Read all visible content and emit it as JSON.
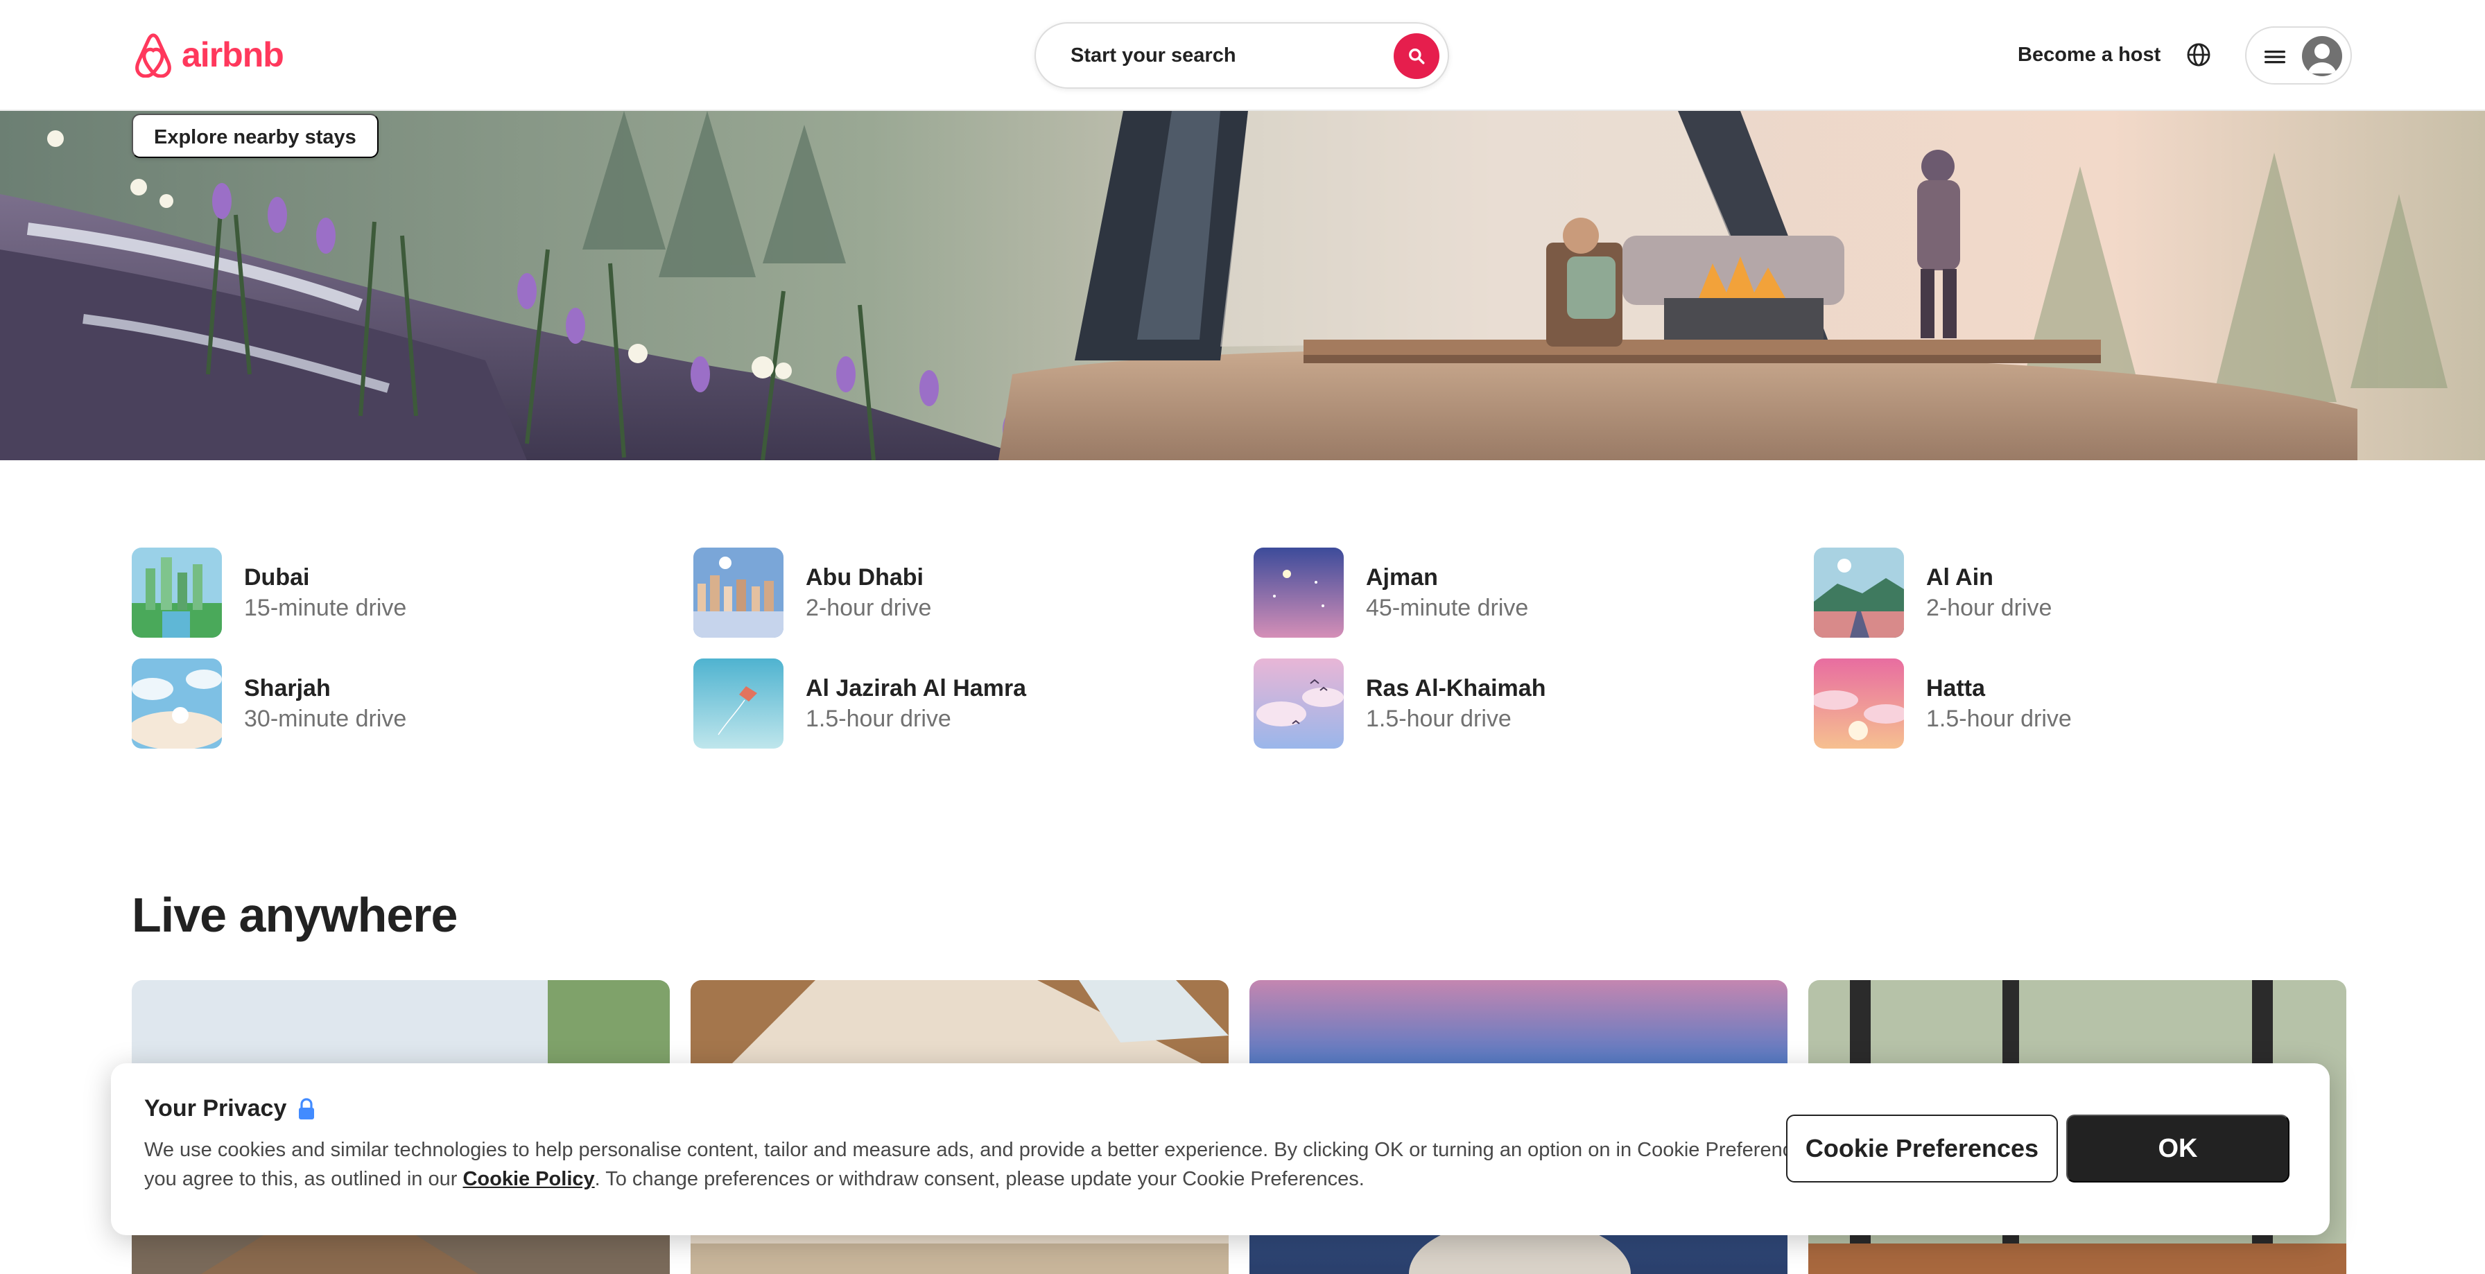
{
  "header": {
    "logo_text": "airbnb",
    "search_placeholder": "Start your search",
    "host_link": "Become a host"
  },
  "hero": {
    "explore_button": "Explore nearby stays"
  },
  "destinations": [
    {
      "city": "Dubai",
      "drive": "15-minute drive"
    },
    {
      "city": "Abu Dhabi",
      "drive": "2-hour drive"
    },
    {
      "city": "Ajman",
      "drive": "45-minute drive"
    },
    {
      "city": "Al Ain",
      "drive": "2-hour drive"
    },
    {
      "city": "Sharjah",
      "drive": "30-minute drive"
    },
    {
      "city": "Al Jazirah Al Hamra",
      "drive": "1.5-hour drive"
    },
    {
      "city": "Ras Al-Khaimah",
      "drive": "1.5-hour drive"
    },
    {
      "city": "Hatta",
      "drive": "1.5-hour drive"
    }
  ],
  "live_anywhere": {
    "title": "Live anywhere"
  },
  "cookie_banner": {
    "title": "Your Privacy",
    "body_before_link": "We use cookies and similar technologies to help personalise content, tailor and measure ads, and provide a better experience. By clicking OK or turning an option on in Cookie Preferences, you agree to this, as outlined in our ",
    "link_text": "Cookie Policy",
    "body_after_link": ". To change preferences or withdraw consent, please update your Cookie Preferences.",
    "preferences_button": "Cookie Preferences",
    "ok_button": "OK"
  },
  "colors": {
    "brand": "#ff385c",
    "search_button": "#e61e4d",
    "text_primary": "#222222",
    "text_secondary": "#717171"
  }
}
